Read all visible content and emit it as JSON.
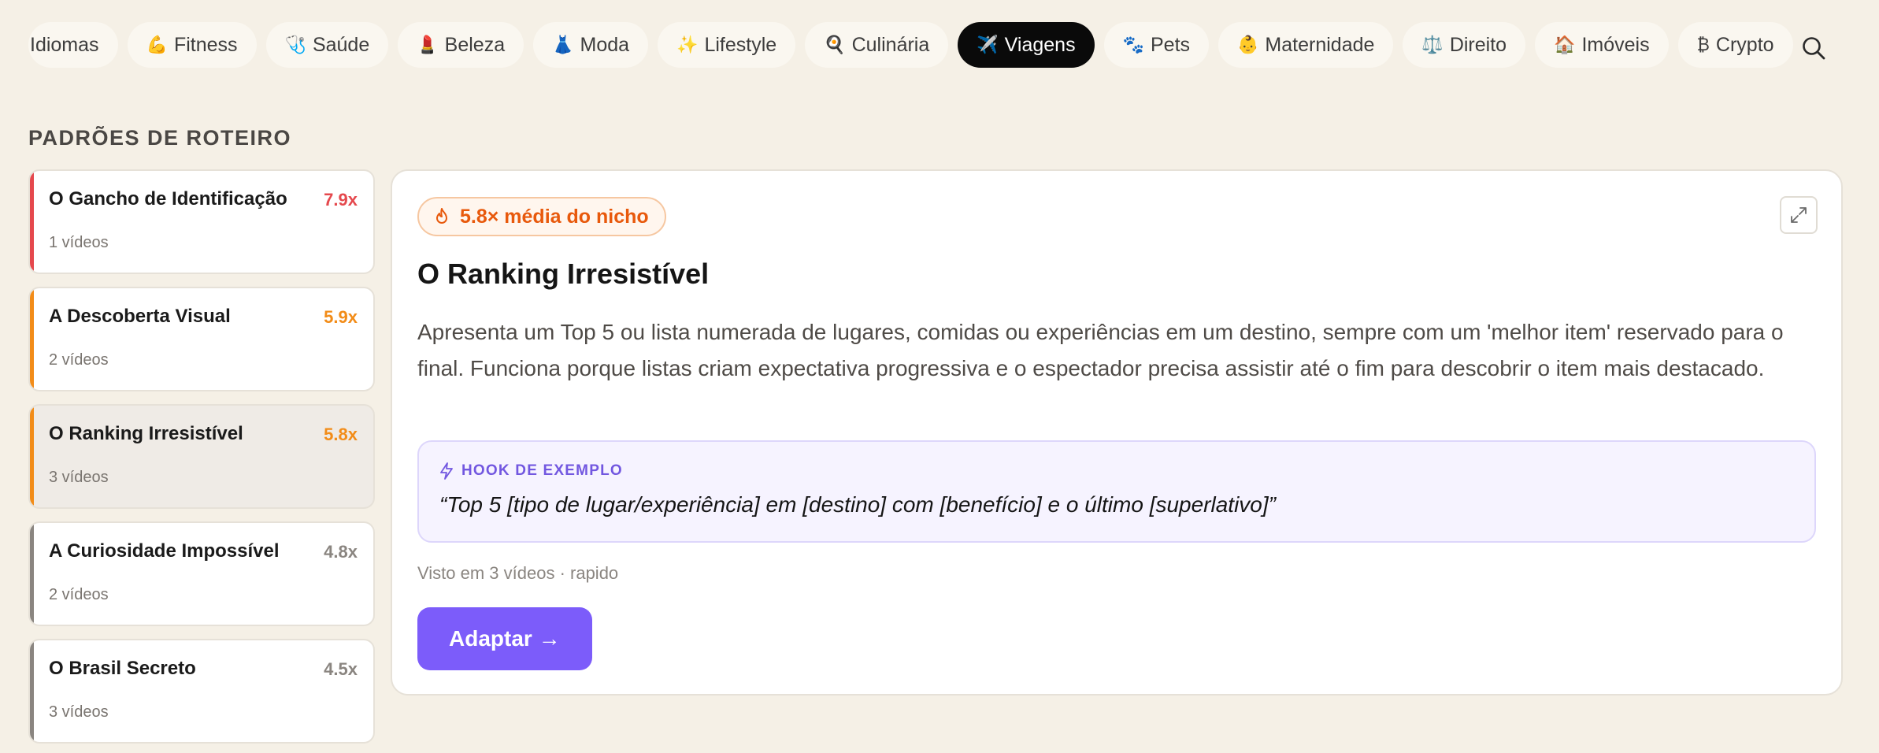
{
  "categories": [
    {
      "glyph": "",
      "label": "Idiomas",
      "active": false
    },
    {
      "glyph": "💪",
      "label": "Fitness",
      "active": false
    },
    {
      "glyph": "🩺",
      "label": "Saúde",
      "active": false
    },
    {
      "glyph": "💄",
      "label": "Beleza",
      "active": false
    },
    {
      "glyph": "👗",
      "label": "Moda",
      "active": false
    },
    {
      "glyph": "✨",
      "label": "Lifestyle",
      "active": false
    },
    {
      "glyph": "🍳",
      "label": "Culinária",
      "active": false
    },
    {
      "glyph": "✈️",
      "label": "Viagens",
      "active": true
    },
    {
      "glyph": "🐾",
      "label": "Pets",
      "active": false
    },
    {
      "glyph": "👶",
      "label": "Maternidade",
      "active": false
    },
    {
      "glyph": "⚖️",
      "label": "Direito",
      "active": false
    },
    {
      "glyph": "🏠",
      "label": "Imóveis",
      "active": false
    },
    {
      "glyph": "₿",
      "label": "Crypto",
      "active": false
    }
  ],
  "section_title": "PADRÕES DE ROTEIRO",
  "patterns": [
    {
      "title": "O Gancho de Identificação",
      "multiplier": "7.9x",
      "videos": "1 vídeos",
      "color": "#e5484d",
      "selected": false
    },
    {
      "title": "A Descoberta Visual",
      "multiplier": "5.9x",
      "videos": "2 vídeos",
      "color": "#f28c18",
      "selected": false
    },
    {
      "title": "O Ranking Irresistível",
      "multiplier": "5.8x",
      "videos": "3 vídeos",
      "color": "#f28c18",
      "selected": true
    },
    {
      "title": "A Curiosidade Impossível",
      "multiplier": "4.8x",
      "videos": "2 vídeos",
      "color": "#8a8580",
      "selected": false
    },
    {
      "title": "O Brasil Secreto",
      "multiplier": "4.5x",
      "videos": "3 vídeos",
      "color": "#8a8580",
      "selected": false
    }
  ],
  "detail": {
    "badge": "5.8× média do nicho",
    "badge_icon": "flame-icon",
    "title": "O Ranking Irresistível",
    "description": "Apresenta um Top 5 ou lista numerada de lugares, comidas ou experiências em um destino, sempre com um 'melhor item' reservado para o final. Funciona porque listas criam expectativa progressiva e o espectador precisa assistir até o fim para descobrir o item mais destacado.",
    "hook_label": "HOOK DE EXEMPLO",
    "hook_text": "“Top 5 [tipo de lugar/experiência] em [destino] com [benefício] e o último [superlativo]”",
    "seen": "Visto em 3 vídeos · rapido",
    "adapt_label": "Adaptar →"
  },
  "colors": {
    "accent": "#7c5cfa",
    "badge": "#e8590c",
    "background": "#f5f0e6"
  }
}
